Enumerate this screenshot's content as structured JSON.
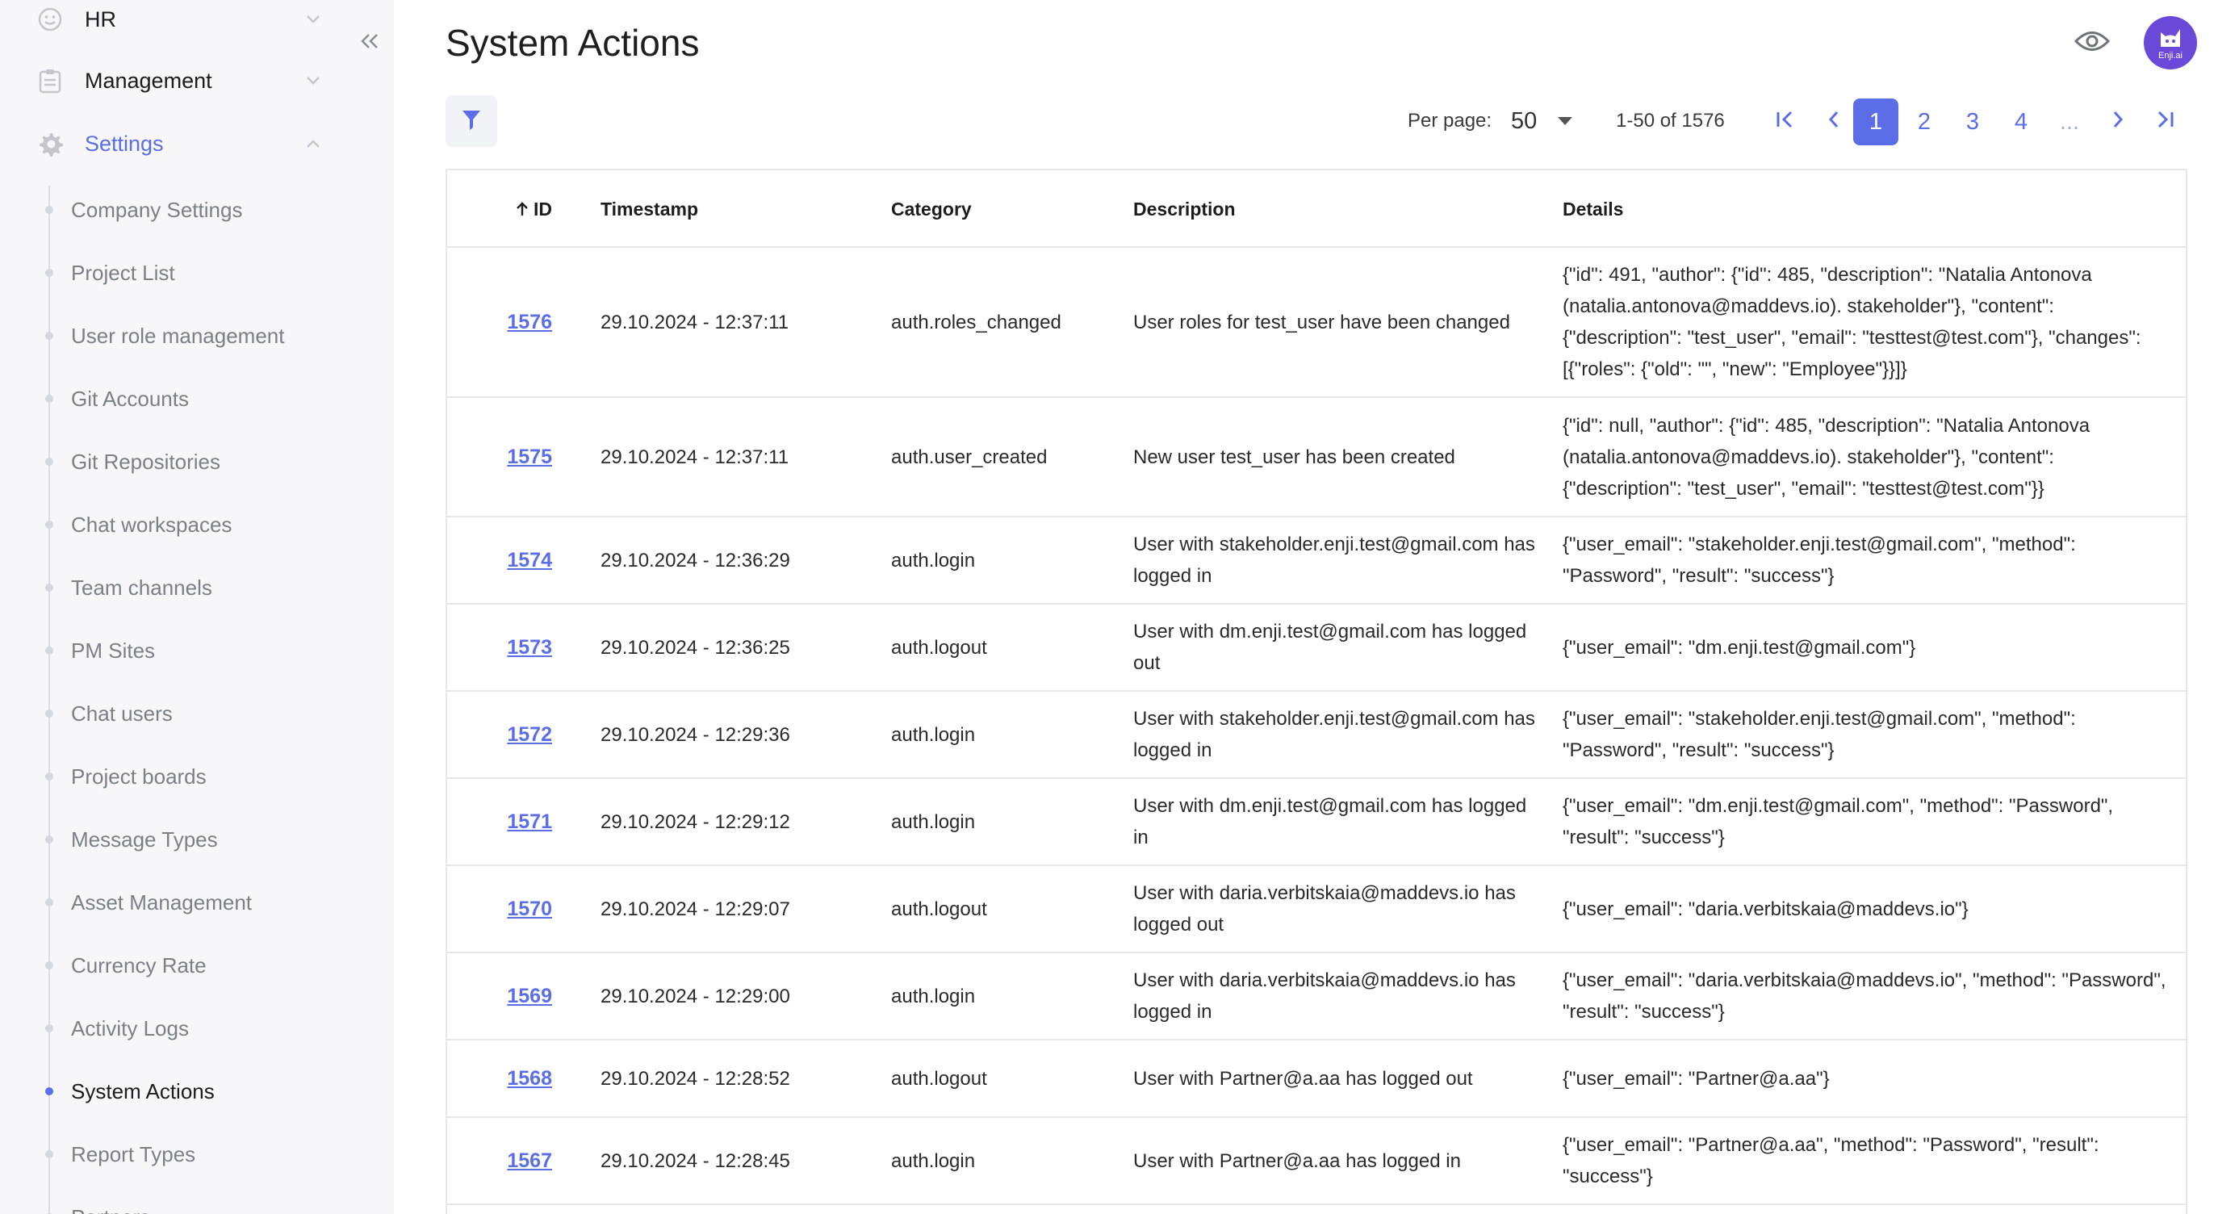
{
  "sidebar": {
    "top_items": [
      {
        "label": "HR",
        "icon": "smiley-icon",
        "expanded": false
      },
      {
        "label": "Management",
        "icon": "clipboard-icon",
        "expanded": false
      },
      {
        "label": "Settings",
        "icon": "gear-icon",
        "expanded": true
      }
    ],
    "sub_items": [
      {
        "label": "Company Settings"
      },
      {
        "label": "Project List"
      },
      {
        "label": "User role management"
      },
      {
        "label": "Git Accounts"
      },
      {
        "label": "Git Repositories"
      },
      {
        "label": "Chat workspaces"
      },
      {
        "label": "Team channels"
      },
      {
        "label": "PM Sites"
      },
      {
        "label": "Chat users"
      },
      {
        "label": "Project boards"
      },
      {
        "label": "Message Types"
      },
      {
        "label": "Asset Management"
      },
      {
        "label": "Currency Rate"
      },
      {
        "label": "Activity Logs"
      },
      {
        "label": "System Actions",
        "active": true
      },
      {
        "label": "Report Types"
      },
      {
        "label": "Partners"
      }
    ]
  },
  "header": {
    "title": "System Actions",
    "avatar_text": "Enji.ai"
  },
  "pagination": {
    "per_page_label": "Per page:",
    "per_page_value": "50",
    "range_text": "1-50 of 1576",
    "pages": [
      "1",
      "2",
      "3",
      "4",
      "..."
    ],
    "current_page": "1"
  },
  "table": {
    "columns": [
      "ID",
      "Timestamp",
      "Category",
      "Description",
      "Details"
    ],
    "sort": {
      "column": "ID",
      "direction": "ascending-arrow"
    },
    "rows": [
      {
        "id": "1576",
        "timestamp": "29.10.2024 - 12:37:11",
        "category": "auth.roles_changed",
        "description": "User roles for test_user have been changed",
        "details": "{\"id\": 491, \"author\": {\"id\": 485, \"description\": \"Natalia Antonova (natalia.antonova@maddevs.io). stakeholder\"}, \"content\": {\"description\": \"test_user\", \"email\": \"testtest@test.com\"}, \"changes\": [{\"roles\": {\"old\": \"\", \"new\": \"Employee\"}}]}"
      },
      {
        "id": "1575",
        "timestamp": "29.10.2024 - 12:37:11",
        "category": "auth.user_created",
        "description": "New user test_user has been created",
        "details": "{\"id\": null, \"author\": {\"id\": 485, \"description\": \"Natalia Antonova (natalia.antonova@maddevs.io). stakeholder\"}, \"content\": {\"description\": \"test_user\", \"email\": \"testtest@test.com\"}}"
      },
      {
        "id": "1574",
        "timestamp": "29.10.2024 - 12:36:29",
        "category": "auth.login",
        "description": "User with stakeholder.enji.test@gmail.com has logged in",
        "details": "{\"user_email\": \"stakeholder.enji.test@gmail.com\", \"method\": \"Password\", \"result\": \"success\"}"
      },
      {
        "id": "1573",
        "timestamp": "29.10.2024 - 12:36:25",
        "category": "auth.logout",
        "description": "User with dm.enji.test@gmail.com has logged out",
        "details": "{\"user_email\": \"dm.enji.test@gmail.com\"}"
      },
      {
        "id": "1572",
        "timestamp": "29.10.2024 - 12:29:36",
        "category": "auth.login",
        "description": "User with stakeholder.enji.test@gmail.com has logged in",
        "details": "{\"user_email\": \"stakeholder.enji.test@gmail.com\", \"method\": \"Password\", \"result\": \"success\"}"
      },
      {
        "id": "1571",
        "timestamp": "29.10.2024 - 12:29:12",
        "category": "auth.login",
        "description": "User with dm.enji.test@gmail.com has logged in",
        "details": "{\"user_email\": \"dm.enji.test@gmail.com\", \"method\": \"Password\", \"result\": \"success\"}"
      },
      {
        "id": "1570",
        "timestamp": "29.10.2024 - 12:29:07",
        "category": "auth.logout",
        "description": "User with daria.verbitskaia@maddevs.io has logged out",
        "details": "{\"user_email\": \"daria.verbitskaia@maddevs.io\"}"
      },
      {
        "id": "1569",
        "timestamp": "29.10.2024 - 12:29:00",
        "category": "auth.login",
        "description": "User with daria.verbitskaia@maddevs.io has logged in",
        "details": "{\"user_email\": \"daria.verbitskaia@maddevs.io\", \"method\": \"Password\", \"result\": \"success\"}"
      },
      {
        "id": "1568",
        "timestamp": "29.10.2024 - 12:28:52",
        "category": "auth.logout",
        "description": "User with Partner@a.aa has logged out",
        "details": "{\"user_email\": \"Partner@a.aa\"}"
      },
      {
        "id": "1567",
        "timestamp": "29.10.2024 - 12:28:45",
        "category": "auth.login",
        "description": "User with Partner@a.aa has logged in",
        "details": "{\"user_email\": \"Partner@a.aa\", \"method\": \"Password\", \"result\": \"success\"}"
      }
    ]
  },
  "colors": {
    "accent": "#5b6ee8",
    "sidebar_bg": "#f7f7f9",
    "avatar_bg": "#6a48d8",
    "border": "#e6e7eb"
  }
}
